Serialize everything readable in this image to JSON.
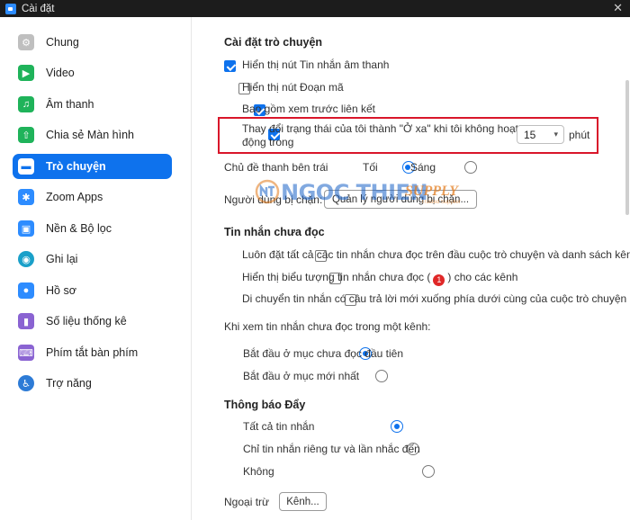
{
  "window": {
    "title": "Cài đặt",
    "close_glyph": "✕"
  },
  "sidebar": {
    "items": [
      {
        "label": "Chung",
        "icon": "gear-icon",
        "color": "#bfbfbf",
        "glyph": "⚙",
        "active": false
      },
      {
        "label": "Video",
        "icon": "video-icon",
        "color": "#1fb35a",
        "glyph": "▶",
        "active": false
      },
      {
        "label": "Âm thanh",
        "icon": "headphones-icon",
        "color": "#1fb35a",
        "glyph": "♫",
        "active": false
      },
      {
        "label": "Chia sẻ Màn hình",
        "icon": "share-screen-icon",
        "color": "#1fb35a",
        "glyph": "⇧",
        "active": false
      },
      {
        "label": "Trò chuyện",
        "icon": "chat-icon",
        "color": "#0e72ed",
        "glyph": "▬",
        "active": true
      },
      {
        "label": "Zoom Apps",
        "icon": "zoom-apps-icon",
        "color": "#2d8cff",
        "glyph": "✱",
        "active": false
      },
      {
        "label": "Nền & Bộ lọc",
        "icon": "background-filter-icon",
        "color": "#2d8cff",
        "glyph": "▣",
        "active": false
      },
      {
        "label": "Ghi lại",
        "icon": "record-icon",
        "color": "#1aa0c9",
        "glyph": "◉",
        "active": false
      },
      {
        "label": "Hồ sơ",
        "icon": "profile-icon",
        "color": "#2d8cff",
        "glyph": "●",
        "active": false
      },
      {
        "label": "Số liệu thống kê",
        "icon": "statistics-icon",
        "color": "#8a63d2",
        "glyph": "▮",
        "active": false
      },
      {
        "label": "Phím tắt bàn phím",
        "icon": "keyboard-icon",
        "color": "#8a63d2",
        "glyph": "⌨",
        "active": false
      },
      {
        "label": "Trợ năng",
        "icon": "accessibility-icon",
        "color": "#2d7bd6",
        "glyph": "♿",
        "active": false
      }
    ]
  },
  "chat_settings": {
    "title": "Cài đặt trò chuyện",
    "options": [
      {
        "label": "Hiển thị nút Tin nhắn âm thanh",
        "checked": true
      },
      {
        "label": "Hiển thị nút Đoạn mã",
        "checked": false
      },
      {
        "label": "Bao gồm xem trước liên kết",
        "checked": true
      }
    ],
    "away": {
      "line1": "Thay đổi trạng thái của tôi thành \"Ở xa\" khi tôi không hoạt",
      "line2": "động trong",
      "checked": true,
      "minutes": "15",
      "unit": "phút"
    },
    "theme": {
      "label": "Chủ đề thanh bên trái",
      "dark": "Tối",
      "light": "Sáng",
      "selected": "dark"
    },
    "blocked": {
      "label": "Người dùng bị chặn",
      "label_visible": "Người dùng bị chặn:",
      "button": "Quản lý người dùng bị chặn..."
    }
  },
  "watermark": {
    "ngoc": "NGOC THIEN",
    "supply": "SUPPLY",
    "sub": "Trusted Supplier"
  },
  "unread": {
    "title": "Tin nhắn chưa đọc",
    "options": [
      {
        "label": "Luôn đặt tất cả các tin nhắn chưa đọc trên đầu cuộc trò chuyện và danh sách kênh",
        "checked": false
      },
      {
        "label_before": "Hiển thị biểu tượng tin nhắn chưa đọc (",
        "badge": "1",
        "label_after": ") cho các kênh",
        "checked": false
      },
      {
        "label": "Di chuyển tin nhắn có câu trả lời mới xuống phía dưới cùng của cuộc trò chuyện",
        "checked": false
      }
    ]
  },
  "viewing": {
    "title": "Khi xem tin nhắn chưa đọc trong một kênh:",
    "options": [
      {
        "label": "Bắt đầu ở mục chưa đọc đầu tiên",
        "selected": true
      },
      {
        "label": "Bắt đầu ở mục mới nhất",
        "selected": false
      }
    ]
  },
  "push": {
    "title": "Thông báo Đẩy",
    "options": [
      {
        "label": "Tất cả tin nhắn",
        "selected": true
      },
      {
        "label": "Chỉ tin nhắn riêng tư và lần nhắc đến",
        "selected": false
      },
      {
        "label": "Không",
        "selected": false
      }
    ],
    "except_label": "Ngoại trừ",
    "channels_button": "Kênh..."
  }
}
